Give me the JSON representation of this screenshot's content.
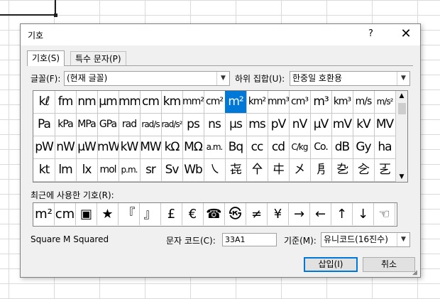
{
  "dialog": {
    "title": "기호",
    "help_label": "?",
    "close_label": "✕"
  },
  "tabs": [
    {
      "label": "기호(S)"
    },
    {
      "label": "특수 문자(P)"
    }
  ],
  "font": {
    "label": "글꼴(F):",
    "value": "(현재 글꼴)"
  },
  "subset": {
    "label": "하위 집합(U):",
    "value": "한중일 호환용"
  },
  "symbol_grid": [
    [
      "kℓ",
      "fm",
      "nm",
      "μm",
      "mm",
      "cm",
      "km",
      "mm²",
      "cm²",
      "m²",
      "km²",
      "mm³",
      "cm³",
      "m³",
      "km³",
      "m/s",
      "m/s²"
    ],
    [
      "Pa",
      "kPa",
      "MPa",
      "GPa",
      "rad",
      "rad/s",
      "rad/s²",
      "ps",
      "ns",
      "μs",
      "ms",
      "pV",
      "nV",
      "μV",
      "mV",
      "kV",
      "MV"
    ],
    [
      "pW",
      "nW",
      "μW",
      "mW",
      "kW",
      "MW",
      "kΩ",
      "MΩ",
      "a.m.",
      "Bq",
      "cc",
      "cd",
      "C/kg",
      "Co.",
      "dB",
      "Gy",
      "ha"
    ],
    [
      "kt",
      "lm",
      "lx",
      "mol",
      "p.m.",
      "sr",
      "Sv",
      "Wb",
      "㇏",
      "㐂",
      "㐃",
      "㐄",
      "㐅",
      "㐆",
      "㐇",
      "㐈",
      "㐉"
    ]
  ],
  "selected_symbol": "m²",
  "recent": {
    "label": "최근에 사용한 기호(R):",
    "symbols": [
      "m²",
      "cm",
      "▣",
      "★",
      "『",
      "』",
      "£",
      "€",
      "☎",
      "㉿",
      "≠",
      "¥",
      "→",
      "←",
      "↑",
      "↓",
      "☜"
    ]
  },
  "char_name": "Square M Squared",
  "char_code": {
    "label": "문자 코드(C):",
    "value": "33A1"
  },
  "basis": {
    "label": "기준(M):",
    "value": "유니코드(16진수)"
  },
  "buttons": {
    "insert": "삽입(I)",
    "cancel": "취소"
  }
}
